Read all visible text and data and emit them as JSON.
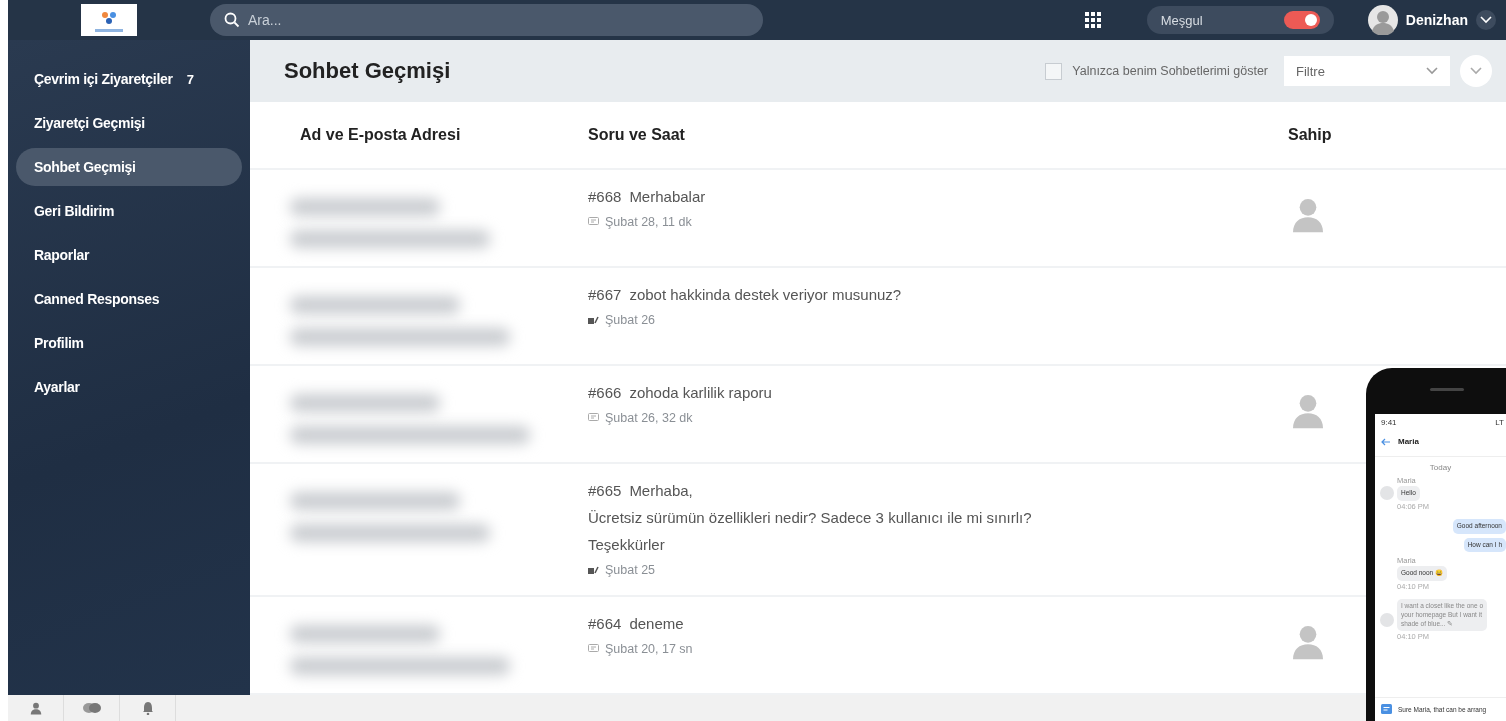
{
  "top_bar": {
    "search": {
      "placeholder": "Ara..."
    },
    "status": {
      "label": "Meşgul",
      "on": true
    },
    "user": {
      "name": "Denizhan"
    }
  },
  "sidebar": {
    "items": [
      {
        "label": "Çevrim içi Ziyaretçiler",
        "count": "7",
        "selected": false
      },
      {
        "label": "Ziyaretçi Geçmişi",
        "selected": false
      },
      {
        "label": "Sohbet Geçmişi",
        "selected": true
      },
      {
        "label": "Geri Bildirim",
        "selected": false
      },
      {
        "label": "Raporlar",
        "selected": false
      },
      {
        "label": "Canned Responses",
        "selected": false
      },
      {
        "label": "Profilim",
        "selected": false
      },
      {
        "label": "Ayarlar",
        "selected": false
      }
    ]
  },
  "header": {
    "title": "Sohbet Geçmişi",
    "only_mine": {
      "label": "Yalnızca benim Sohbetlerimi göster",
      "checked": false
    },
    "filter": {
      "placeholder": "Filtre"
    }
  },
  "table": {
    "columns": [
      "Ad ve E-posta Adresi",
      "Soru ve Saat",
      "Sahip"
    ],
    "rows": [
      {
        "number": "#668",
        "lines": [
          "Merhabalar"
        ],
        "time": "Şubat 28, 11 dk",
        "kind": "missed",
        "has_owner": true
      },
      {
        "number": "#667",
        "lines": [
          "zobot hakkinda destek veriyor musunuz?"
        ],
        "time": "Şubat 26",
        "kind": "answered",
        "has_owner": false
      },
      {
        "number": "#666",
        "lines": [
          "zohoda karlilik raporu"
        ],
        "time": "Şubat 26, 32 dk",
        "kind": "missed",
        "has_owner": true
      },
      {
        "number": "#665",
        "lines": [
          "Merhaba,",
          "Ücretsiz sürümün özellikleri nedir? Sadece 3 kullanıcı ile mi sınırlı?",
          "Teşekkürler"
        ],
        "time": "Şubat 25",
        "kind": "answered",
        "has_owner": false
      },
      {
        "number": "#664",
        "lines": [
          "deneme"
        ],
        "time": "Şubat 20, 17 sn",
        "kind": "missed",
        "has_owner": true
      }
    ]
  },
  "phone": {
    "clock": "9:41",
    "network": "LT",
    "contact": "Maria",
    "day": "Today",
    "messages": [
      {
        "kind": "in",
        "sender": "Maria",
        "lines": [
          "Hello"
        ],
        "time": "04:06 PM",
        "avatar": true
      },
      {
        "kind": "out",
        "lines": [
          "Good afternoon"
        ]
      },
      {
        "kind": "out",
        "lines": [
          "How can I h"
        ]
      },
      {
        "kind": "in",
        "sender": "Maria",
        "lines": [
          "Good noon 😄"
        ],
        "time": "04:10 PM",
        "avatar": false
      },
      {
        "kind": "in",
        "lines": [
          "I want a closet like the one o",
          "your homepage But I want it",
          "shade of blue... ✎"
        ],
        "time": "04:10 PM",
        "avatar": true,
        "faded": true
      }
    ],
    "composer": "Sure Maria, that can be arrang"
  }
}
